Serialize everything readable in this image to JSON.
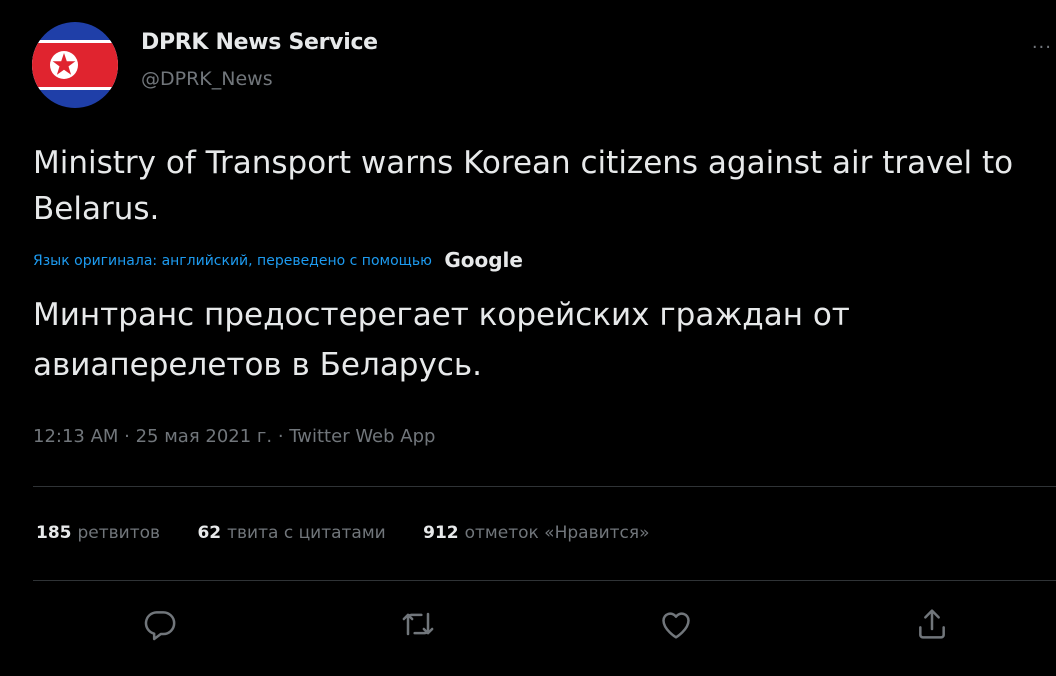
{
  "author": {
    "display_name": "DPRK News Service",
    "handle": "@DPRK_News",
    "flag_colors": {
      "blue": "#1f3fa8",
      "white": "#ffffff",
      "red": "#e0242f",
      "star": "#e0242f"
    }
  },
  "more_icon": "more-horizontal-icon",
  "more_label": "...",
  "tweet": {
    "text": "Ministry of Transport warns Korean citizens against air travel to Belarus.",
    "translation_note": "Язык оригинала: английский, переведено с помощью",
    "translation_provider": "Google",
    "translated_text": "Минтранс предостерегает корейских граждан от авиаперелетов в Беларусь.",
    "meta": "12:13 AM · 25 мая 2021 г. · Twitter Web App"
  },
  "stats": {
    "retweets_count": "185",
    "retweets_label": "ретвитов",
    "quotes_count": "62",
    "quotes_label": "твита с цитатами",
    "likes_count": "912",
    "likes_label": "отметок «Нравится»"
  },
  "actions": [
    {
      "name": "reply",
      "icon": "reply-icon"
    },
    {
      "name": "retweet",
      "icon": "retweet-icon"
    },
    {
      "name": "like",
      "icon": "heart-icon"
    },
    {
      "name": "share",
      "icon": "share-icon"
    }
  ],
  "colors": {
    "background": "#000000",
    "text": "#e7e9ea",
    "secondary": "#71767b",
    "link": "#1d9bf0",
    "divider": "#2f3336"
  }
}
